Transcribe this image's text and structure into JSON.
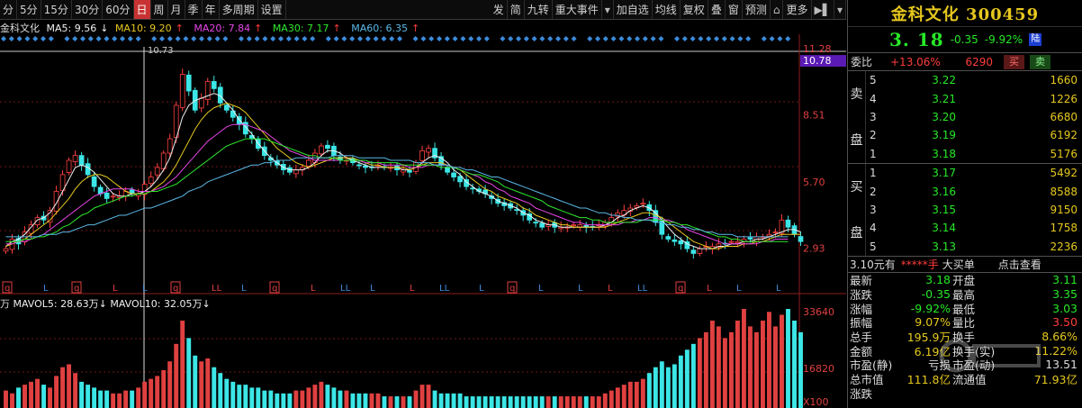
{
  "toolbar": {
    "periods": [
      "分",
      "5分",
      "15分",
      "30分",
      "60分",
      "日",
      "周",
      "月",
      "季",
      "年",
      "多周期",
      "设置"
    ],
    "active_period": "日",
    "tools": [
      "发",
      "简",
      "九转",
      "重大事件",
      "加自选",
      "均线",
      "复权",
      "叠",
      "窗",
      "预测",
      "更多"
    ]
  },
  "ma_legend": {
    "name": "金科文化",
    "ma5": "MA5: 9.56",
    "ma10": "MA10: 9.20",
    "ma20": "MA20: 7.84",
    "ma30": "MA30: 7.17",
    "ma60": "MA60: 6.35",
    "colors": {
      "name": "#dcdcdc",
      "ma5": "#f0f0f0",
      "ma10": "#e6c81e",
      "ma20": "#e646e6",
      "ma30": "#2ee82e",
      "ma60": "#5ab8e6"
    }
  },
  "vol_legend": {
    "prefix": "万",
    "mavol5": "MAVOL5: 28.63万",
    "mavol10": "MAVOL10: 32.05万"
  },
  "price_axis": {
    "labels": [
      "11.28",
      "8.51",
      "5.70",
      "2.93"
    ],
    "current_tag": "10.78",
    "peak_label": "10.73"
  },
  "volume_axis": {
    "labels": [
      "33640",
      "16820",
      "X100"
    ]
  },
  "markers": [
    "q",
    "L",
    "q",
    "L",
    "L",
    "q",
    "LL",
    "L",
    "q",
    "L",
    "LL",
    "L",
    "L",
    "LL",
    "L",
    "q",
    "L",
    "L",
    "L",
    "LL",
    "q",
    "L",
    "L",
    "L"
  ],
  "panel": {
    "name": "金科文化 300459",
    "price": "3. 18",
    "change": "-0.35",
    "pct": "-9.92%",
    "market": "陆",
    "ratio_label": "委比",
    "ratio_value": "+13.06%",
    "ratio_diff": "6290",
    "buy_btn": "买",
    "sell_btn": "卖",
    "sell_label": [
      "卖",
      "盘"
    ],
    "buy_label": [
      "买",
      "盘"
    ],
    "asks": [
      {
        "level": "5",
        "price": "3.22",
        "vol": "1660"
      },
      {
        "level": "4",
        "price": "3.21",
        "vol": "1226"
      },
      {
        "level": "3",
        "price": "3.20",
        "vol": "6680"
      },
      {
        "level": "2",
        "price": "3.19",
        "vol": "6192"
      },
      {
        "level": "1",
        "price": "3.18",
        "vol": "5176"
      }
    ],
    "bids": [
      {
        "level": "1",
        "price": "3.17",
        "vol": "5492"
      },
      {
        "level": "2",
        "price": "3.16",
        "vol": "8588"
      },
      {
        "level": "3",
        "price": "3.15",
        "vol": "9150"
      },
      {
        "level": "4",
        "price": "3.14",
        "vol": "1758"
      },
      {
        "level": "5",
        "price": "3.13",
        "vol": "2236"
      }
    ],
    "trade_bar": {
      "a": "3.10元有",
      "b": "*****手",
      "c": "大买单",
      "d": "点击查看"
    },
    "stats": [
      {
        "k1": "最新",
        "v1": "3.18",
        "c1": "green",
        "k2": "开盘",
        "v2": "3.11",
        "c2": "green"
      },
      {
        "k1": "涨跌",
        "v1": "-0.35",
        "c1": "green",
        "k2": "最高",
        "v2": "3.35",
        "c2": "green"
      },
      {
        "k1": "涨幅",
        "v1": "-9.92%",
        "c1": "green",
        "k2": "最低",
        "v2": "3.03",
        "c2": "green"
      },
      {
        "k1": "振幅",
        "v1": "9.07%",
        "c1": "yellow",
        "k2": "量比",
        "v2": "3.50",
        "c2": "red"
      },
      {
        "k1": "总手",
        "v1": "195.9万",
        "c1": "yellow",
        "k2": "换手",
        "v2": "8.66%",
        "c2": "yellow"
      },
      {
        "k1": "金额",
        "v1": "6.19亿",
        "c1": "yellow",
        "k2": "换手(实)",
        "v2": "11.22%",
        "c2": "yellow"
      },
      {
        "k1": "市盈(静)",
        "v1": "亏损",
        "c1": "white",
        "k2": "市盈(动)",
        "v2": "13.51",
        "c2": "white"
      },
      {
        "k1": "总市值",
        "v1": "111.8亿",
        "c1": "yellow",
        "k2": "流通值",
        "v2": "71.93亿",
        "c2": "yellow"
      },
      {
        "k1": "涨跌",
        "v1": "",
        "c1": "white",
        "k2": "",
        "v2": "",
        "c2": "white"
      }
    ]
  },
  "chart_data": {
    "type": "candlestick",
    "price_range": [
      2.0,
      11.5
    ],
    "volume_max": 33640,
    "close": [
      2.9,
      3.3,
      3.1,
      3.6,
      3.9,
      4.2,
      4.1,
      4.5,
      5.3,
      6.0,
      6.6,
      6.8,
      6.4,
      6.0,
      5.5,
      5.2,
      5.0,
      5.1,
      5.1,
      5.3,
      5.2,
      5.2,
      5.6,
      5.9,
      6.3,
      6.9,
      7.5,
      8.9,
      10.2,
      9.5,
      8.7,
      9.2,
      9.9,
      9.6,
      9.0,
      8.7,
      8.4,
      8.1,
      7.7,
      7.5,
      7.1,
      6.8,
      6.6,
      6.4,
      6.2,
      6.1,
      6.2,
      6.3,
      6.6,
      6.9,
      7.2,
      7.1,
      6.8,
      6.6,
      6.6,
      6.5,
      6.4,
      6.3,
      6.3,
      6.4,
      6.3,
      6.3,
      6.2,
      6.2,
      6.1,
      6.5,
      7.0,
      7.1,
      6.7,
      6.4,
      6.1,
      5.9,
      5.7,
      5.5,
      5.4,
      5.3,
      5.2,
      5.0,
      4.8,
      4.7,
      4.6,
      4.5,
      4.3,
      4.1,
      4.0,
      3.8,
      3.9,
      3.8,
      3.8,
      3.8,
      3.9,
      3.9,
      3.8,
      3.8,
      3.9,
      4.0,
      4.2,
      4.4,
      4.5,
      4.6,
      4.7,
      4.8,
      4.5,
      4.0,
      3.5,
      3.3,
      3.2,
      3.1,
      2.9,
      2.7,
      2.9,
      3.0,
      3.0,
      3.1,
      3.1,
      3.2,
      3.2,
      3.3,
      3.3,
      3.4,
      3.4,
      3.5,
      3.6,
      4.1,
      3.8,
      3.5,
      3.2
    ],
    "ma_series": [
      {
        "name": "MA5",
        "color": "#f0f0f0",
        "values": [
          3.0,
          3.2,
          3.3,
          3.5,
          3.8,
          4.1,
          4.2,
          4.4,
          4.8,
          5.3,
          5.8,
          6.3,
          6.4,
          6.3,
          6.1,
          5.8,
          5.5,
          5.2,
          5.1,
          5.1,
          5.2,
          5.2,
          5.3,
          5.5,
          5.8,
          6.2,
          6.7,
          7.5,
          8.4,
          8.9,
          9.1,
          9.2,
          9.3,
          9.4,
          9.3,
          9.0,
          8.7,
          8.3,
          8.0,
          7.7,
          7.3,
          7.0,
          6.7,
          6.5,
          6.3,
          6.2,
          6.2,
          6.2,
          6.3,
          6.5,
          6.8,
          7.0,
          7.0,
          6.9,
          6.7,
          6.6,
          6.5,
          6.4,
          6.3,
          6.3,
          6.3,
          6.3,
          6.3,
          6.2,
          6.2,
          6.3,
          6.5,
          6.7,
          6.8,
          6.7,
          6.5,
          6.2,
          6.0,
          5.7,
          5.5,
          5.3,
          5.2,
          5.1,
          4.9,
          4.8,
          4.7,
          4.6,
          4.4,
          4.3,
          4.1,
          4.0,
          3.9,
          3.9,
          3.8,
          3.8,
          3.8,
          3.8,
          3.8,
          3.8,
          3.8,
          3.9,
          4.0,
          4.2,
          4.3,
          4.5,
          4.6,
          4.7,
          4.6,
          4.4,
          4.1,
          3.8,
          3.5,
          3.3,
          3.1,
          3.0,
          2.9,
          2.9,
          2.9,
          3.0,
          3.0,
          3.1,
          3.1,
          3.2,
          3.2,
          3.3,
          3.3,
          3.4,
          3.5,
          3.6,
          3.7,
          3.7,
          3.6
        ]
      },
      {
        "name": "MA10",
        "color": "#e6c81e",
        "values": [
          3.0,
          3.1,
          3.2,
          3.3,
          3.5,
          3.7,
          3.9,
          4.1,
          4.4,
          4.7,
          5.0,
          5.4,
          5.7,
          5.9,
          6.0,
          6.0,
          5.9,
          5.7,
          5.5,
          5.3,
          5.2,
          5.2,
          5.2,
          5.3,
          5.5,
          5.7,
          6.0,
          6.4,
          6.9,
          7.4,
          7.9,
          8.3,
          8.6,
          8.8,
          8.9,
          9.0,
          8.9,
          8.8,
          8.6,
          8.3,
          8.0,
          7.7,
          7.4,
          7.1,
          6.9,
          6.7,
          6.5,
          6.4,
          6.3,
          6.4,
          6.5,
          6.6,
          6.7,
          6.7,
          6.7,
          6.7,
          6.6,
          6.5,
          6.4,
          6.4,
          6.3,
          6.3,
          6.3,
          6.3,
          6.2,
          6.3,
          6.4,
          6.5,
          6.5,
          6.5,
          6.4,
          6.3,
          6.2,
          6.0,
          5.8,
          5.6,
          5.4,
          5.3,
          5.1,
          5.0,
          4.9,
          4.8,
          4.6,
          4.5,
          4.3,
          4.2,
          4.1,
          4.0,
          3.9,
          3.9,
          3.8,
          3.8,
          3.8,
          3.8,
          3.8,
          3.8,
          3.9,
          4.0,
          4.1,
          4.2,
          4.3,
          4.4,
          4.4,
          4.3,
          4.2,
          4.0,
          3.8,
          3.6,
          3.4,
          3.2,
          3.1,
          3.0,
          2.9,
          2.9,
          3.0,
          3.0,
          3.0,
          3.1,
          3.1,
          3.2,
          3.2,
          3.3,
          3.4,
          3.5,
          3.5,
          3.5,
          3.5
        ]
      },
      {
        "name": "MA20",
        "color": "#e646e6",
        "values": [
          3.1,
          3.1,
          3.2,
          3.2,
          3.3,
          3.4,
          3.5,
          3.7,
          3.9,
          4.1,
          4.3,
          4.5,
          4.7,
          4.9,
          5.1,
          5.2,
          5.3,
          5.4,
          5.4,
          5.4,
          5.4,
          5.3,
          5.3,
          5.3,
          5.4,
          5.5,
          5.7,
          5.9,
          6.2,
          6.5,
          6.8,
          7.1,
          7.4,
          7.6,
          7.8,
          8.0,
          8.1,
          8.1,
          8.1,
          8.0,
          7.9,
          7.8,
          7.6,
          7.4,
          7.2,
          7.0,
          6.9,
          6.8,
          6.7,
          6.6,
          6.6,
          6.6,
          6.6,
          6.6,
          6.6,
          6.6,
          6.6,
          6.5,
          6.5,
          6.5,
          6.4,
          6.4,
          6.4,
          6.4,
          6.3,
          6.3,
          6.3,
          6.4,
          6.4,
          6.4,
          6.4,
          6.3,
          6.2,
          6.1,
          6.0,
          5.9,
          5.7,
          5.6,
          5.4,
          5.3,
          5.1,
          5.0,
          4.9,
          4.8,
          4.6,
          4.5,
          4.4,
          4.3,
          4.2,
          4.1,
          4.0,
          4.0,
          3.9,
          3.9,
          3.9,
          3.9,
          3.9,
          3.9,
          4.0,
          4.0,
          4.1,
          4.1,
          4.2,
          4.2,
          4.1,
          4.1,
          4.0,
          3.9,
          3.7,
          3.6,
          3.5,
          3.4,
          3.3,
          3.2,
          3.1,
          3.1,
          3.1,
          3.1,
          3.1,
          3.1,
          3.2,
          3.2,
          3.3,
          3.3,
          3.3
        ]
      },
      {
        "name": "MA30",
        "color": "#2ee82e",
        "values": [
          3.2,
          3.2,
          3.2,
          3.3,
          3.3,
          3.4,
          3.4,
          3.5,
          3.6,
          3.8,
          3.9,
          4.1,
          4.3,
          4.4,
          4.6,
          4.7,
          4.8,
          4.9,
          5.0,
          5.1,
          5.1,
          5.2,
          5.2,
          5.3,
          5.3,
          5.4,
          5.5,
          5.6,
          5.8,
          6.0,
          6.2,
          6.4,
          6.6,
          6.8,
          7.0,
          7.2,
          7.3,
          7.4,
          7.5,
          7.5,
          7.5,
          7.5,
          7.4,
          7.3,
          7.2,
          7.1,
          7.0,
          6.9,
          6.8,
          6.8,
          6.7,
          6.7,
          6.7,
          6.6,
          6.6,
          6.6,
          6.6,
          6.6,
          6.5,
          6.5,
          6.5,
          6.5,
          6.5,
          6.4,
          6.4,
          6.4,
          6.4,
          6.4,
          6.4,
          6.3,
          6.3,
          6.3,
          6.2,
          6.1,
          6.0,
          6.0,
          5.9,
          5.8,
          5.7,
          5.5,
          5.4,
          5.3,
          5.2,
          5.1,
          5.0,
          4.9,
          4.7,
          4.6,
          4.5,
          4.4,
          4.3,
          4.2,
          4.2,
          4.1,
          4.1,
          4.0,
          4.0,
          4.0,
          4.0,
          4.0,
          4.0,
          4.1,
          4.1,
          4.1,
          4.1,
          4.0,
          4.0,
          3.9,
          3.9,
          3.8,
          3.7,
          3.6,
          3.5,
          3.4,
          3.4,
          3.3,
          3.3,
          3.2,
          3.2,
          3.2,
          3.2,
          3.2,
          3.2,
          3.2,
          3.2
        ]
      },
      {
        "name": "MA60",
        "color": "#5ab8e6",
        "values": [
          3.4,
          3.4,
          3.4,
          3.4,
          3.4,
          3.4,
          3.5,
          3.5,
          3.5,
          3.6,
          3.6,
          3.7,
          3.8,
          3.9,
          3.9,
          4.0,
          4.1,
          4.2,
          4.3,
          4.3,
          4.4,
          4.5,
          4.6,
          4.6,
          4.7,
          4.8,
          4.9,
          5.0,
          5.1,
          5.3,
          5.4,
          5.5,
          5.7,
          5.8,
          5.9,
          6.0,
          6.1,
          6.2,
          6.3,
          6.4,
          6.4,
          6.5,
          6.5,
          6.6,
          6.6,
          6.6,
          6.7,
          6.7,
          6.7,
          6.7,
          6.7,
          6.7,
          6.8,
          6.8,
          6.8,
          6.8,
          6.7,
          6.7,
          6.7,
          6.7,
          6.7,
          6.6,
          6.6,
          6.6,
          6.6,
          6.5,
          6.5,
          6.5,
          6.4,
          6.4,
          6.4,
          6.3,
          6.3,
          6.2,
          6.2,
          6.1,
          6.0,
          5.9,
          5.9,
          5.8,
          5.7,
          5.6,
          5.5,
          5.4,
          5.3,
          5.2,
          5.1,
          5.0,
          4.9,
          4.8,
          4.7,
          4.6,
          4.6,
          4.5,
          4.4,
          4.4,
          4.3,
          4.3,
          4.2,
          4.2,
          4.1,
          4.1,
          4.1,
          4.0,
          4.0,
          3.9,
          3.9,
          3.8,
          3.8,
          3.7,
          3.7,
          3.6,
          3.6,
          3.5,
          3.5,
          3.5,
          3.4,
          3.4,
          3.4,
          3.4,
          3.4,
          3.4,
          3.4,
          3.4,
          3.4
        ]
      }
    ],
    "volume": [
      6,
      5,
      7,
      8,
      9,
      10,
      8,
      7,
      11,
      14,
      15,
      12,
      9,
      8,
      7,
      6,
      6,
      5,
      5,
      6,
      6,
      7,
      9,
      10,
      11,
      13,
      16,
      22,
      30,
      24,
      18,
      16,
      17,
      14,
      12,
      10,
      9,
      8,
      8,
      7,
      7,
      6,
      6,
      5,
      5,
      5,
      6,
      6,
      7,
      8,
      9,
      8,
      7,
      6,
      6,
      5,
      5,
      5,
      5,
      5,
      4,
      4,
      4,
      4,
      4,
      6,
      8,
      8,
      6,
      5,
      5,
      5,
      5,
      4,
      4,
      4,
      4,
      4,
      4,
      4,
      4,
      4,
      4,
      4,
      4,
      4,
      4,
      4,
      4,
      4,
      4,
      4,
      4,
      4,
      4,
      5,
      6,
      7,
      8,
      9,
      9,
      10,
      12,
      14,
      16,
      14,
      15,
      18,
      20,
      22,
      24,
      26,
      30,
      28,
      24,
      26,
      30,
      34,
      28,
      26,
      30,
      33,
      28,
      32,
      34,
      30,
      26
    ]
  }
}
